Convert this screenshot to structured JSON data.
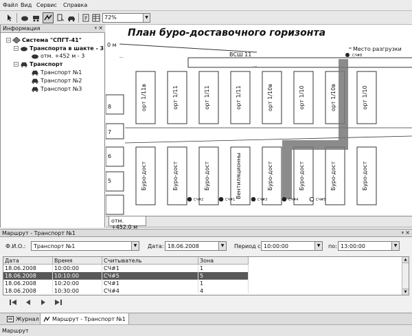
{
  "menu": [
    "Файл",
    "Вид",
    "Сервис",
    "Справка"
  ],
  "toolbar": {
    "zoom_value": "72%",
    "buttons": [
      "pointer-icon",
      "ore-icon",
      "route-icon",
      "reader-icon",
      "transport-icon",
      "report-icon",
      "table-icon"
    ]
  },
  "info_panel": {
    "title": "Информация",
    "pin": "ᵠ",
    "close": "×",
    "tree": {
      "system": "Система \"СПГТ-41\"",
      "in_shaft": "Транспорта в шакте - 3",
      "level_node": "отм. +452 м - 3",
      "transport": "Транспорт",
      "items": [
        "Транспорт №1",
        "Транспорт №2",
        "Транспорт №3"
      ]
    }
  },
  "map": {
    "title": "План буро-доставочного горизонта",
    "level_fragment": "0 м",
    "drift_label": "ВСШ 11",
    "unload_label": "Место разгрузки",
    "reader_top": "СЧ#8",
    "orts": [
      "орт 1/11в",
      "орт 1/11",
      "орт 1/11",
      "орт 1/11",
      "орт 1/10в",
      "орт 1/10",
      "орт 1/10в",
      "орт 1/10"
    ],
    "drifts": [
      "Буро-дост",
      "Буро-дост",
      "Буро-дост",
      "Вентиляционны",
      "Буро-дост",
      "Буро-дост",
      "Буро-дост",
      "Буро-дост"
    ],
    "row_numbers": [
      "8",
      "7",
      "6",
      "5"
    ],
    "readers": [
      "СЧ#2",
      "СЧ#1",
      "СЧ#3",
      "СЧ#4",
      "СЧ#5"
    ],
    "level_tab": "отм. +452,0 м"
  },
  "route_panel": {
    "title": "Маршрут - Транспорт №1",
    "pin": "ᵠ",
    "close": "×",
    "fio_label": "Ф.И.О.:",
    "fio_value": "Транспорт №1",
    "date_label": "Дата:",
    "date_value": "18.06.2008",
    "period_from_label": "Период с:",
    "period_from_value": "10:00:00",
    "period_to_label": "по:",
    "period_to_value": "13:00:00",
    "table": {
      "headers": [
        "Дата",
        "Время",
        "Считыватель",
        "Зона"
      ],
      "rows": [
        [
          "18.06.2008",
          "10:00:00",
          "СЧ#1",
          "1"
        ],
        [
          "18.06.2008",
          "10:10:00",
          "СЧ#5",
          "5"
        ],
        [
          "18.06.2008",
          "10:20:00",
          "СЧ#1",
          "1"
        ],
        [
          "18.06.2008",
          "10:30:00",
          "СЧ#4",
          "4"
        ]
      ]
    }
  },
  "bottom_tabs": [
    "Журнал",
    "Маршрут - Транспорт №1"
  ],
  "status": "Маршрут"
}
